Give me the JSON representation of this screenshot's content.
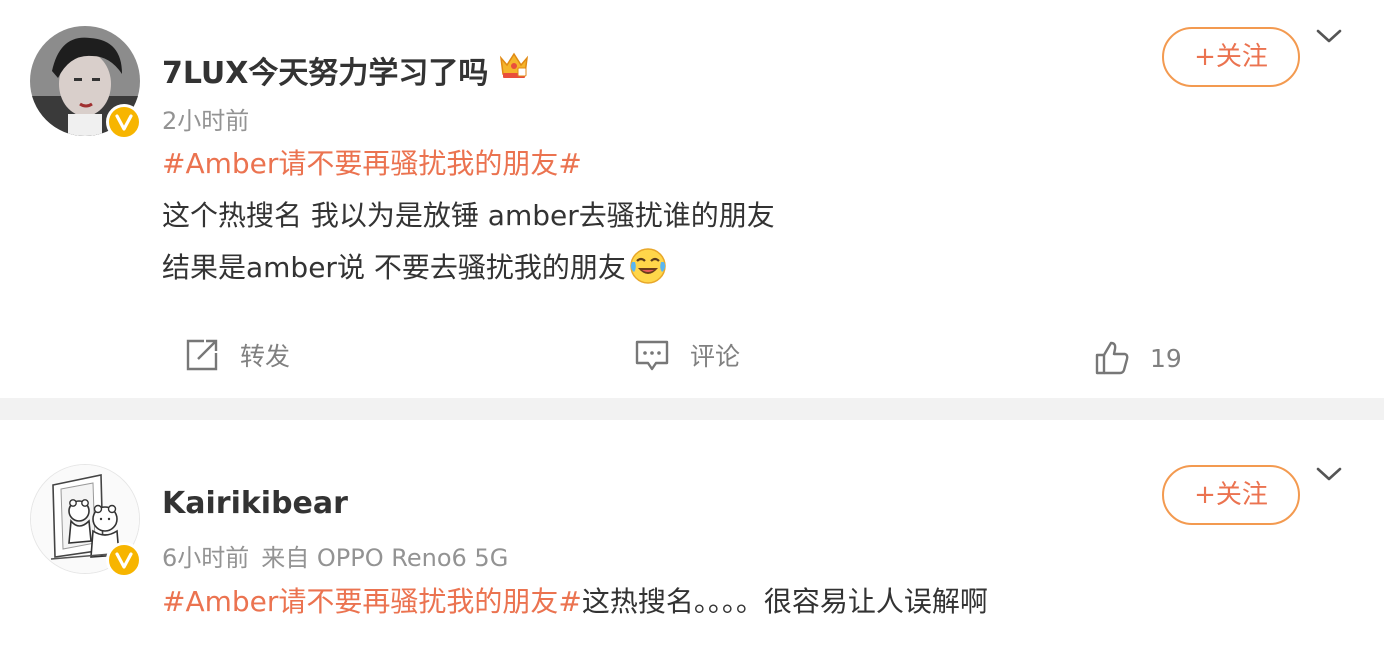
{
  "posts": [
    {
      "username": "7LUX今天努力学习了吗",
      "time": "2小时前",
      "source": "",
      "follow_label": "+关注",
      "hashtag": "#Amber请不要再骚扰我的朋友#",
      "lines": [
        "这个热搜名 我以为是放锤 amber去骚扰谁的朋友",
        "结果是amber说 不要去骚扰我的朋友"
      ],
      "actions": {
        "repost_label": "转发",
        "comment_label": "评论",
        "like_count": "19"
      }
    },
    {
      "username": "Kairikibear",
      "time": "6小时前",
      "source": "来自 OPPO Reno6 5G",
      "follow_label": "+关注",
      "hashtag": "#Amber请不要再骚扰我的朋友#",
      "text_after_hashtag": "这热搜名。。。。很容易让人误解啊"
    }
  ],
  "colors": {
    "accent": "#eb7350",
    "verified": "#f7b500",
    "divider": "#f2f2f2",
    "meta": "#939393"
  },
  "icons": [
    "crown-icon",
    "verified-badge-icon",
    "chevron-down-icon",
    "repost-icon",
    "comment-icon",
    "like-icon",
    "laugh-cry-emoji-icon"
  ]
}
